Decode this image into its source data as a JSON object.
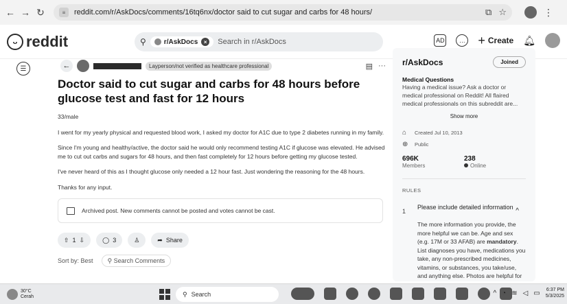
{
  "browser": {
    "url": "reddit.com/r/AskDocs/comments/16tq6nx/doctor said to cut sugar and carbs for 48 hours/"
  },
  "header": {
    "logo_text": "reddit",
    "search_chip": "r/AskDocs",
    "search_placeholder": "Search in r/AskDocs",
    "create_label": "Create"
  },
  "post": {
    "flair": "Layperson/not verified as healthcare professional",
    "title": "Doctor said to cut sugar and carbs for 48 hours before glucose test and fast for 12 hours",
    "paragraphs": [
      "33/male",
      "I went for my yearly physical and requested blood work, I asked my doctor for A1C due to type 2 diabetes running in my family.",
      "Since I'm young and healthy/active, the doctor said he would only recommend testing A1C if glucose was elevated. He advised me to cut out carbs and sugars for 48 hours, and then fast completely for 12 hours before getting my glucose tested.",
      "I've never heard of this as I thought glucose only needed a 12 hour fast. Just wondering the reasoning for the 48 hours.",
      "Thanks for any input."
    ],
    "archived_notice": "Archived post. New comments cannot be posted and votes cannot be cast.",
    "votes": "1",
    "comments": "3",
    "share_label": "Share",
    "sort_label": "Sort by: Best",
    "search_comments": "Search Comments"
  },
  "sidebar": {
    "name": "r/AskDocs",
    "joined_label": "Joined",
    "subtitle": "Medical Questions",
    "description": "Having a medical issue? Ask a doctor or medical professional on Reddit! All flaired medical professionals on this subreddit are...",
    "show_more": "Show more",
    "created": "Created Jul 10, 2013",
    "visibility": "Public",
    "members_value": "696K",
    "members_label": "Members",
    "online_value": "238",
    "online_label": "Online",
    "rules_heading": "RULES",
    "rule_number": "1",
    "rule_title": "Please include detailed information",
    "rule_body_1": "The more information you provide, the more helpful we can be. Age and sex (e.g. 17M or 33 AFAB) are ",
    "rule_body_bold": "mandatory",
    "rule_body_2": ". List diagnoses you have, medications you take, any non-prescribed medicines, vitamins, or substances, you take/use, and anything else. Photos are helpful for"
  },
  "taskbar": {
    "temperature": "30°C",
    "weather": "Cerah",
    "search_label": "Search",
    "time": "6:37 PM",
    "date": "5/3/2025"
  }
}
